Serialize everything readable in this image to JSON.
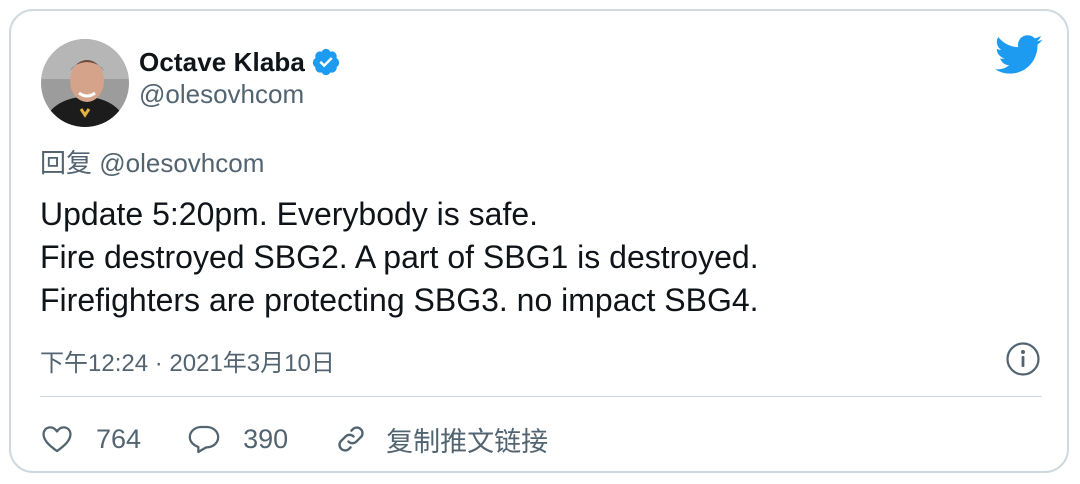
{
  "author": {
    "name": "Octave Klaba",
    "handle": "@olesovhcom",
    "verified": true
  },
  "reply": {
    "prefix": "回复",
    "handle": "@olesovhcom"
  },
  "tweet": {
    "lines": [
      "Update 5:20pm. Everybody is safe.",
      "Fire destroyed SBG2. A part of SBG1 is destroyed.",
      "Firefighters are protecting SBG3. no impact SBG4."
    ]
  },
  "meta": {
    "time": "下午12:24",
    "separator": "·",
    "date": "2021年3月10日"
  },
  "actions": {
    "likes": "764",
    "replies": "390",
    "copy_link": "复制推文链接"
  },
  "icons": {
    "brand": "twitter-bird-icon",
    "verified": "verified-badge-icon",
    "info": "info-icon",
    "like": "heart-icon",
    "reply": "speech-bubble-icon",
    "link": "link-icon"
  },
  "colors": {
    "brand": "#1d9bf0",
    "text": "#0f1419",
    "secondary": "#536471",
    "border": "#cfd9de"
  }
}
